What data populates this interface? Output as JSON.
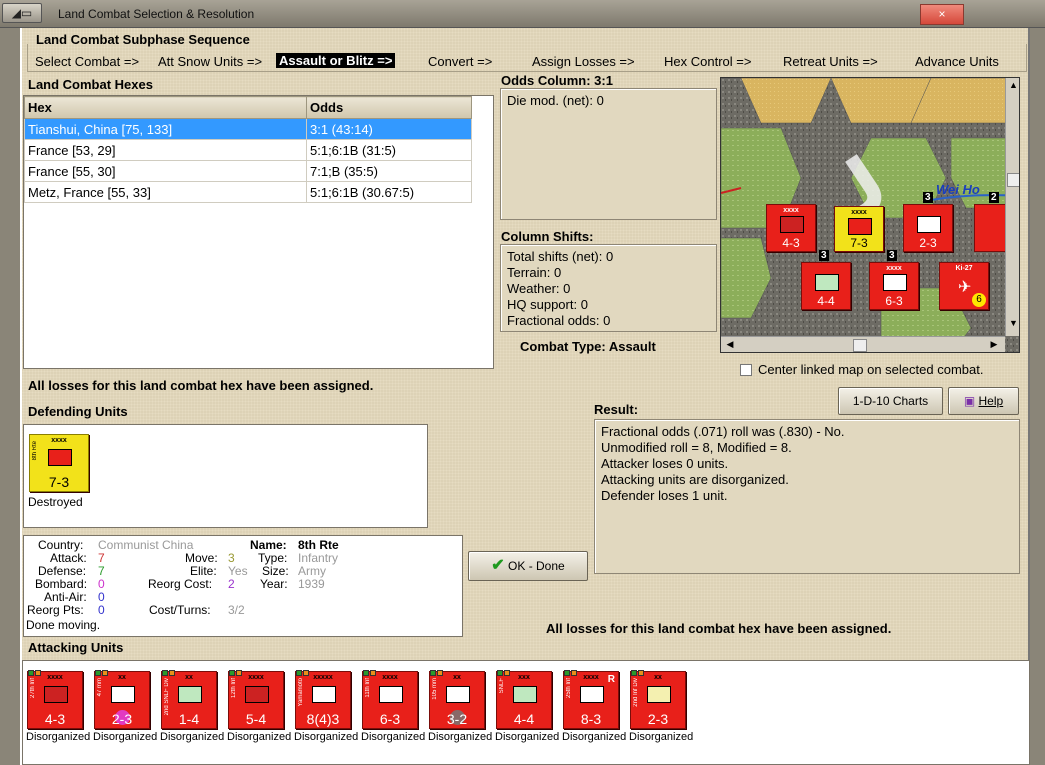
{
  "window": {
    "title": "Land Combat Selection & Resolution",
    "close": "×"
  },
  "sequence": {
    "title": "Land Combat Subphase Sequence",
    "steps": [
      "Select Combat =>",
      "Att Snow Units =>",
      "Assault or Blitz =>",
      "Convert =>",
      "Assign Losses =>",
      "Hex Control =>",
      "Retreat Units =>",
      "Advance Units"
    ]
  },
  "hexes": {
    "title": "Land Combat Hexes",
    "headers": [
      "Hex",
      "Odds"
    ],
    "rows": [
      [
        "Tianshui, China [75, 133]",
        "3:1 (43:14)"
      ],
      [
        "France [53, 29]",
        "5:1;6:1B (31:5)"
      ],
      [
        "France [55, 30]",
        "7:1;B (35:5)"
      ],
      [
        "Metz, France [55, 33]",
        "5:1;6:1B (30.67:5)"
      ]
    ]
  },
  "odds": {
    "title": "Odds Column: 3:1",
    "die_mod": "Die mod. (net): 0"
  },
  "shifts": {
    "title": "Column Shifts:",
    "lines": [
      "Total shifts (net): 0",
      "Terrain: 0",
      "Weather: 0",
      "HQ support: 0",
      "Fractional odds: 0"
    ]
  },
  "combat_type": "Combat Type:  Assault",
  "map": {
    "river_label": "Wei Ho",
    "center_checkbox": "Center linked map on selected combat.",
    "counters": [
      {
        "name": "27th Inf",
        "size": "xxxx",
        "value": "4-3"
      },
      {
        "name": "8th Rte",
        "size": "xxxx",
        "value": "7-3"
      },
      {
        "name": "",
        "size": "",
        "value": "2-3"
      },
      {
        "name": "",
        "size": "",
        "value": "4-4"
      },
      {
        "name": "11th Inf",
        "size": "xxxx",
        "value": "6-3"
      },
      {
        "name": "Ki-27",
        "size": "",
        "value": "6"
      }
    ],
    "stack_counts": [
      "3",
      "3",
      "2",
      "3"
    ]
  },
  "all_losses_msg": "All losses for this land combat hex have been assigned.",
  "defending": {
    "title": "Defending Units",
    "unit": {
      "name": "8th Rte",
      "size": "xxxx",
      "value": "7-3",
      "status": "Destroyed"
    }
  },
  "details": {
    "country_label": "Country:",
    "country": "Communist China",
    "attack_label": "Attack:",
    "attack": "7",
    "defense_label": "Defense:",
    "defense": "7",
    "bombard_label": "Bombard:",
    "bombard": "0",
    "antiair_label": "Anti-Air:",
    "antiair": "0",
    "reorg_label": "Reorg Pts:",
    "reorg": "0",
    "done": "Done moving.",
    "name_label": "Name:",
    "name": "8th Rte",
    "move_label": "Move:",
    "move": "3",
    "elite_label": "Elite:",
    "elite": "Yes",
    "reorgcost_label": "Reorg Cost:",
    "reorgcost": "2",
    "cost_label": "Cost/Turns:",
    "cost": "3/2",
    "type_label": "Type:",
    "type": "Infantry",
    "size_label": "Size:",
    "size": "Army",
    "year_label": "Year:",
    "year": "1939"
  },
  "buttons": {
    "charts": "1-D-10 Charts",
    "help": "Help",
    "ok": "OK - Done"
  },
  "result": {
    "title": "Result:",
    "lines": [
      "Fractional odds (.071) roll was (.830)  - No.",
      "Unmodified roll = 8, Modified = 8.",
      "Attacker loses 0 units.",
      "Attacking units are disorganized.",
      "Defender loses 1 unit."
    ]
  },
  "attacking": {
    "title": "Attacking Units",
    "units": [
      {
        "name": "27th Inf",
        "size": "xxxx",
        "value": "4-3",
        "status": "Disorganized",
        "color": "#e8201a",
        "sym": "#c22",
        "hl": "#e8201a"
      },
      {
        "name": "47 mm",
        "size": "xx",
        "value": "2-3",
        "status": "Disorganized",
        "color": "#e8201a",
        "sym": "#fff",
        "hl": "#e040e0"
      },
      {
        "name": "2nd SNLF Div",
        "size": "xx",
        "value": "1-4",
        "status": "Disorganized",
        "color": "#e8201a",
        "sym": "#bfe8bf",
        "hl": "#e8201a"
      },
      {
        "name": "12th Inf",
        "size": "xxxx",
        "value": "5-4",
        "status": "Disorganized",
        "color": "#e8201a",
        "sym": "#c22",
        "hl": "#e8201a"
      },
      {
        "name": "Yamamoto",
        "size": "xxxxx",
        "value": "8(4)3",
        "status": "Disorganized",
        "color": "#e8201a",
        "sym": "#fff",
        "hl": "#e8201a"
      },
      {
        "name": "11th Inf",
        "size": "xxxx",
        "value": "6-3",
        "status": "Disorganized",
        "color": "#e8201a",
        "sym": "#fff",
        "hl": "#e8201a"
      },
      {
        "name": "105 mm",
        "size": "xx",
        "value": "3-2",
        "status": "Disorganized",
        "color": "#e8201a",
        "sym": "#fff",
        "hl": "#777"
      },
      {
        "name": "SNLF",
        "size": "xxx",
        "value": "4-4",
        "status": "Disorganized",
        "color": "#e8201a",
        "sym": "#bfe8bf",
        "hl": "#e8201a"
      },
      {
        "name": "25th Inf",
        "size": "xxxx",
        "value": "8-3",
        "status": "Disorganized",
        "color": "#e8201a",
        "sym": "#fff",
        "hl": "#e8201a"
      },
      {
        "name": "2nd Inf Div",
        "size": "xx",
        "value": "2-3",
        "status": "Disorganized",
        "color": "#e8201a",
        "sym": "#f4f0b0",
        "hl": "#e8201a"
      }
    ],
    "r_badge": "R"
  }
}
